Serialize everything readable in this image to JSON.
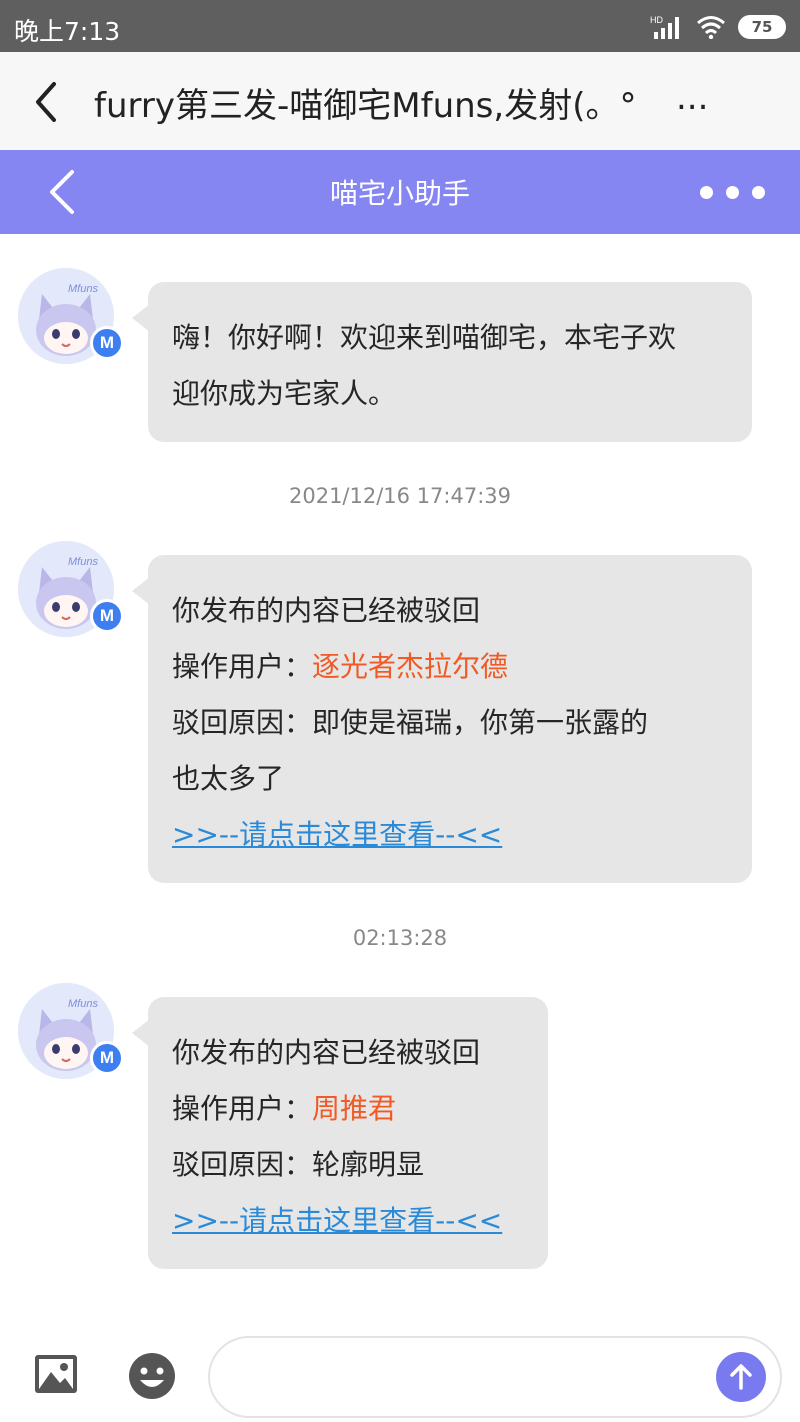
{
  "status_bar": {
    "time": "晚上7:13",
    "signal_label": "HD",
    "battery": "75"
  },
  "title_bar": {
    "title": "furry第三发-喵御宅Mfuns,发射(。°",
    "ellipsis": "..."
  },
  "header": {
    "title": "喵宅小助手"
  },
  "messages": [
    {
      "avatar_text": "Mfuns",
      "badge": "M",
      "lines": [
        "嗨！你好啊！欢迎来到喵御宅，本宅子欢",
        "迎你成为宅家人。"
      ]
    },
    {
      "timestamp": "2021/12/16 17:47:39",
      "avatar_text": "Mfuns",
      "badge": "M",
      "line1": "你发布的内容已经被驳回",
      "operator_label": "操作用户：",
      "operator": "逐光者杰拉尔德",
      "reason_lines": [
        "驳回原因：即使是福瑞，你第一张露的",
        "也太多了"
      ],
      "link": ">>--请点击这里查看--<<"
    },
    {
      "timestamp": "02:13:28",
      "avatar_text": "Mfuns",
      "badge": "M",
      "line1": "你发布的内容已经被驳回",
      "operator_label": "操作用户：",
      "operator": "周推君",
      "reason_lines": [
        "驳回原因：轮廓明显"
      ],
      "link": ">>--请点击这里查看--<<"
    }
  ],
  "input": {
    "placeholder": ""
  },
  "icons": {
    "back": "chevron-left-icon",
    "more": "more-dots-icon",
    "image": "image-icon",
    "emoji": "emoji-icon",
    "send": "arrow-up-icon"
  },
  "colors": {
    "header": "#8686f3",
    "highlight": "#f15a24",
    "link": "#2a8ad8",
    "send": "#7a7af0"
  }
}
